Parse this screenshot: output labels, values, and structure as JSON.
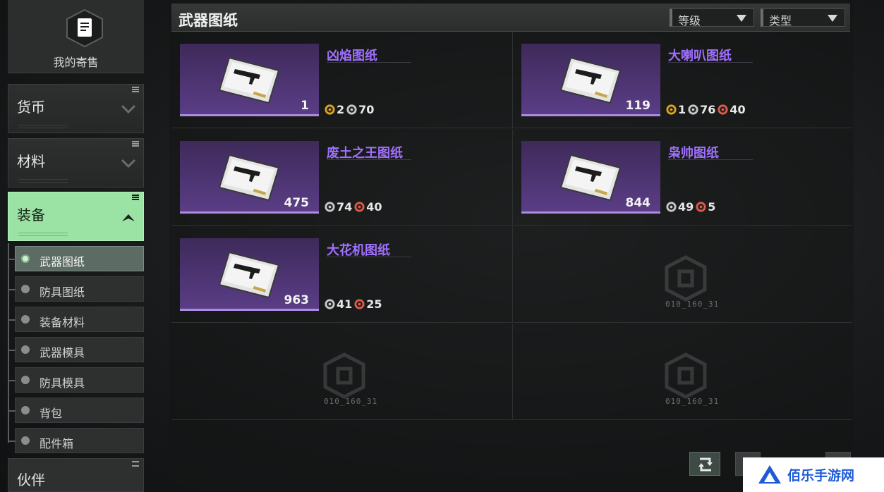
{
  "sidebar": {
    "my_sale": "我的寄售",
    "categories": {
      "currency": "货币",
      "materials": "材料",
      "equipment": "装备",
      "partner": "伙伴"
    },
    "sub_items": [
      "武器图纸",
      "防具图纸",
      "装备材料",
      "武器模具",
      "防具模具",
      "背包",
      "配件箱"
    ],
    "active_sub": "武器图纸"
  },
  "header": {
    "title": "武器图纸",
    "filters": {
      "level": "等级",
      "type": "类型"
    }
  },
  "items": [
    {
      "name": "凶焰图纸",
      "count": "1",
      "costs": [
        {
          "icon": "gold-gear-icon",
          "value": "2"
        },
        {
          "icon": "silver-gear-icon",
          "value": "70"
        }
      ]
    },
    {
      "name": "大喇叭图纸",
      "count": "119",
      "costs": [
        {
          "icon": "gold-gear-icon",
          "value": "1"
        },
        {
          "icon": "silver-gear-icon",
          "value": "76"
        },
        {
          "icon": "red-gear-icon",
          "value": "40"
        }
      ]
    },
    {
      "name": "废土之王图纸",
      "count": "475",
      "costs": [
        {
          "icon": "silver-gear-icon",
          "value": "74"
        },
        {
          "icon": "red-gear-icon",
          "value": "40"
        }
      ]
    },
    {
      "name": "枭帅图纸",
      "count": "844",
      "costs": [
        {
          "icon": "silver-gear-icon",
          "value": "49"
        },
        {
          "icon": "red-gear-icon",
          "value": "5"
        }
      ]
    },
    {
      "name": "大花机图纸",
      "count": "963",
      "costs": [
        {
          "icon": "silver-gear-icon",
          "value": "41"
        },
        {
          "icon": "red-gear-icon",
          "value": "25"
        }
      ]
    }
  ],
  "empty_slot_code": "010_160_31",
  "watermark": "佰乐手游网",
  "colors": {
    "accent_green": "#9be3a4",
    "item_name_purple": "#a070ff",
    "card_purple": "#5a3d86"
  }
}
